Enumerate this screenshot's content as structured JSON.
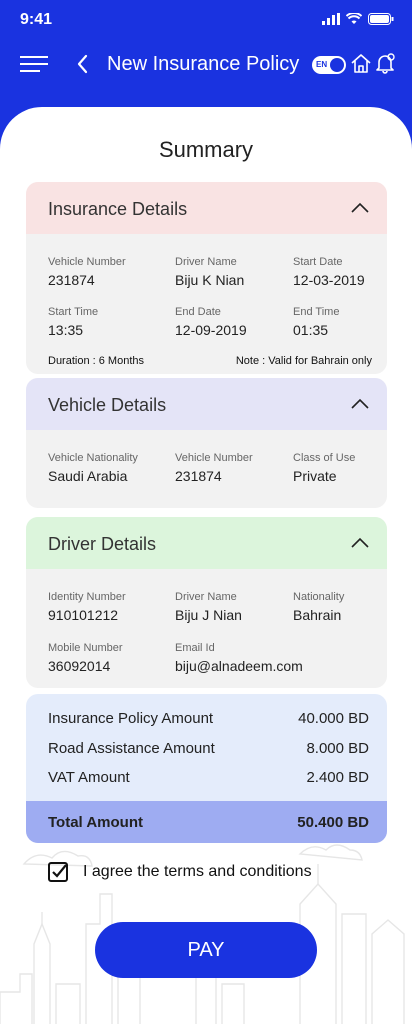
{
  "status_bar": {
    "time": "9:41"
  },
  "header": {
    "title": "New Insurance Policy",
    "language_toggle": "EN"
  },
  "page": {
    "section_title": "Summary"
  },
  "insurance_details": {
    "title": "Insurance Details",
    "color": "#f9e3e3",
    "fields": [
      {
        "label": "Vehicle Number",
        "value": "231874"
      },
      {
        "label": "Driver Name",
        "value": "Biju K Nian"
      },
      {
        "label": "Start Date",
        "value": "12-03-2019"
      },
      {
        "label": "Start Time",
        "value": "13:35"
      },
      {
        "label": "End Date",
        "value": "12-09-2019"
      },
      {
        "label": "End Time",
        "value": "01:35"
      }
    ],
    "duration": "Duration : 6 Months",
    "note": "Note : Valid for Bahrain only"
  },
  "vehicle_details": {
    "title": "Vehicle Details",
    "color": "#e4e4f7",
    "fields": [
      {
        "label": "Vehicle Nationality",
        "value": "Saudi Arabia"
      },
      {
        "label": "Vehicle Number",
        "value": "231874"
      },
      {
        "label": "Class of Use",
        "value": "Private"
      }
    ]
  },
  "driver_details": {
    "title": "Driver Details",
    "color": "#dcf5dc",
    "fields": [
      {
        "label": "Identity Number",
        "value": "910101212"
      },
      {
        "label": "Driver Name",
        "value": "Biju J Nian"
      },
      {
        "label": "Nationality",
        "value": "Bahrain"
      },
      {
        "label": "Mobile Number",
        "value": "36092014"
      },
      {
        "label": "Email Id",
        "value": "biju@alnadeem.com"
      }
    ]
  },
  "amounts": {
    "rows": [
      {
        "label": "Insurance Policy Amount",
        "value": "40.000  BD"
      },
      {
        "label": "Road Assistance Amount",
        "value": "8.000  BD"
      },
      {
        "label": "VAT Amount",
        "value": "2.400  BD"
      }
    ],
    "total_label": "Total Amount",
    "total_value": "50.400  BD"
  },
  "agreement": {
    "label": "I agree the  terms and conditions",
    "checked": true
  },
  "pay_button": {
    "label": "PAY"
  },
  "colors": {
    "brand": "#1a33e0",
    "total_bar": "#9eacf2",
    "amount_bg": "#e4ecfb"
  }
}
